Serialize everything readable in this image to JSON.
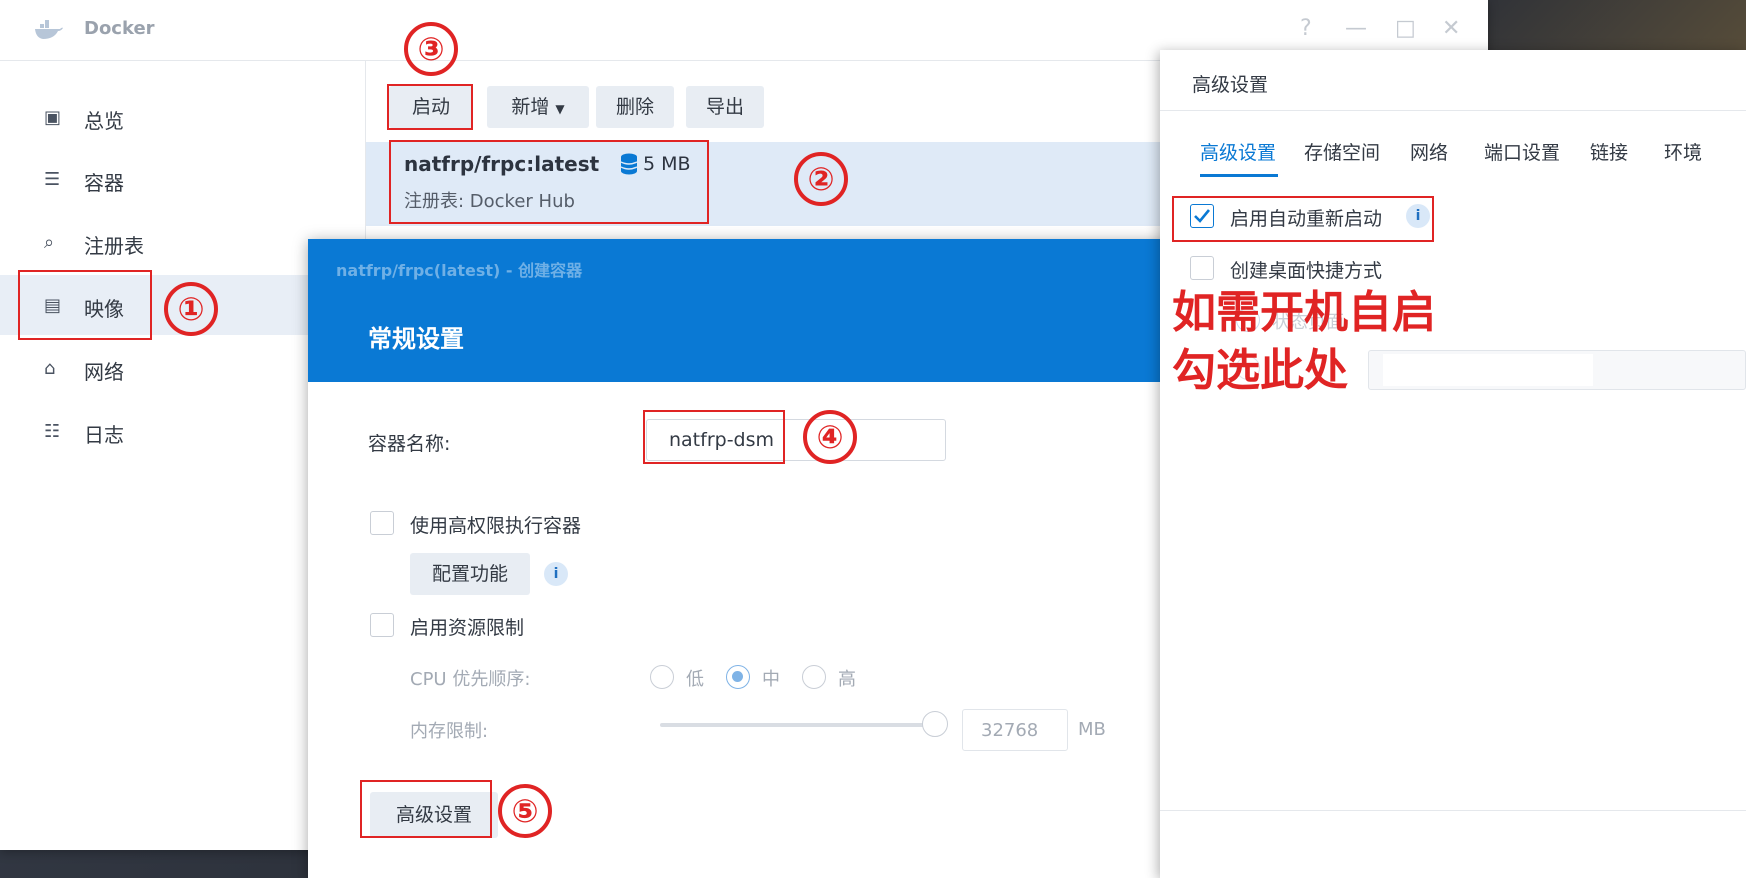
{
  "app": {
    "title": "Docker",
    "controls": [
      "?",
      "—",
      "□",
      "✕"
    ]
  },
  "sidebar": {
    "items": [
      {
        "label": "总览",
        "icon": "overview-icon"
      },
      {
        "label": "容器",
        "icon": "container-icon"
      },
      {
        "label": "注册表",
        "icon": "registry-icon"
      },
      {
        "label": "映像",
        "icon": "image-icon",
        "active": true
      },
      {
        "label": "网络",
        "icon": "network-icon"
      },
      {
        "label": "日志",
        "icon": "log-icon"
      }
    ]
  },
  "toolbar": {
    "start": "启动",
    "add": "新增",
    "delete": "删除",
    "export": "导出"
  },
  "image_row": {
    "name": "natfrp/frpc:latest",
    "size": "5 MB",
    "registry": "注册表: Docker Hub"
  },
  "dialog": {
    "subtitle": "natfrp/frpc(latest) - 创建容器",
    "title": "常规设置",
    "name_label": "容器名称:",
    "name_value": "natfrp-dsm",
    "privileged_label": "使用高权限执行容器",
    "config_button": "配置功能",
    "resource_label": "启用资源限制",
    "cpu_label": "CPU 优先顺序:",
    "cpu_low": "低",
    "cpu_mid": "中",
    "cpu_high": "高",
    "mem_label": "内存限制:",
    "mem_value": "32768",
    "mem_unit": "MB",
    "advanced_button": "高级设置"
  },
  "advanced": {
    "title": "高级设置",
    "tabs": [
      "高级设置",
      "存储空间",
      "网络",
      "端口设置",
      "链接",
      "环境"
    ],
    "auto_restart": "启用自动重新启动",
    "desktop_shortcut": "创建桌面快捷方式",
    "status_page": "状态页面"
  },
  "annotations": {
    "n1": "①",
    "n2": "②",
    "n3": "③",
    "n4": "④",
    "n5": "⑤",
    "note_line1": "如需开机自启",
    "note_line2": "勾选此处"
  },
  "colors": {
    "accent": "#0a79d4",
    "annotation": "#e02424"
  }
}
